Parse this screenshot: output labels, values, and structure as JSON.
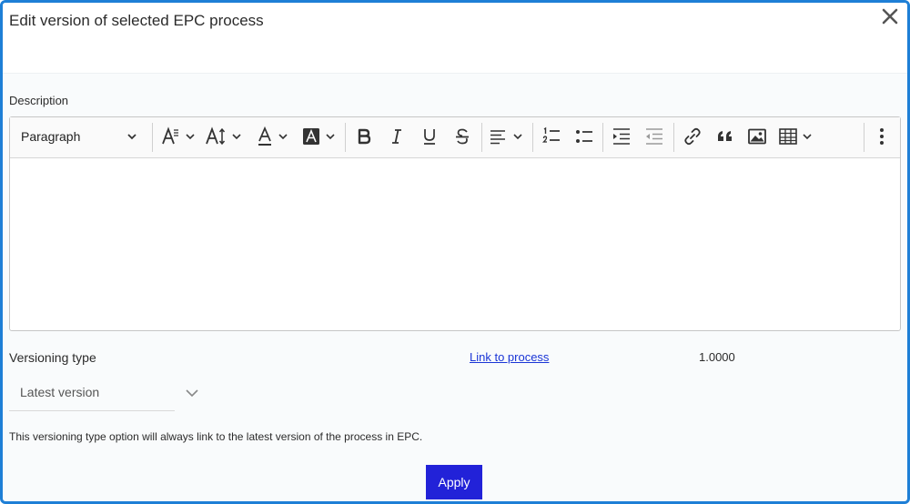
{
  "dialog": {
    "title": "Edit version of selected EPC process",
    "close_icon": "close-icon"
  },
  "description": {
    "label": "Description",
    "content": ""
  },
  "toolbar": {
    "paragraph_style": "Paragraph",
    "icons": [
      "font-family-icon",
      "font-size-icon",
      "font-color-icon",
      "font-background-color-icon",
      "bold-icon",
      "italic-icon",
      "underline-icon",
      "strikethrough-icon",
      "align-left-icon",
      "numbered-list-icon",
      "bulleted-list-icon",
      "indent-icon",
      "outdent-icon",
      "link-icon",
      "blockquote-icon",
      "image-icon",
      "table-icon",
      "more-options-icon"
    ]
  },
  "versioning": {
    "label": "Versioning type",
    "link_text": "Link to process",
    "version_number": "1.0000",
    "selected": "Latest version",
    "help_text": "This versioning type option will always link to the latest version of the process in EPC."
  },
  "actions": {
    "apply_label": "Apply"
  },
  "colors": {
    "frame_border": "#1e7fd6",
    "apply_button": "#2222d8",
    "link": "#1a35d6"
  }
}
